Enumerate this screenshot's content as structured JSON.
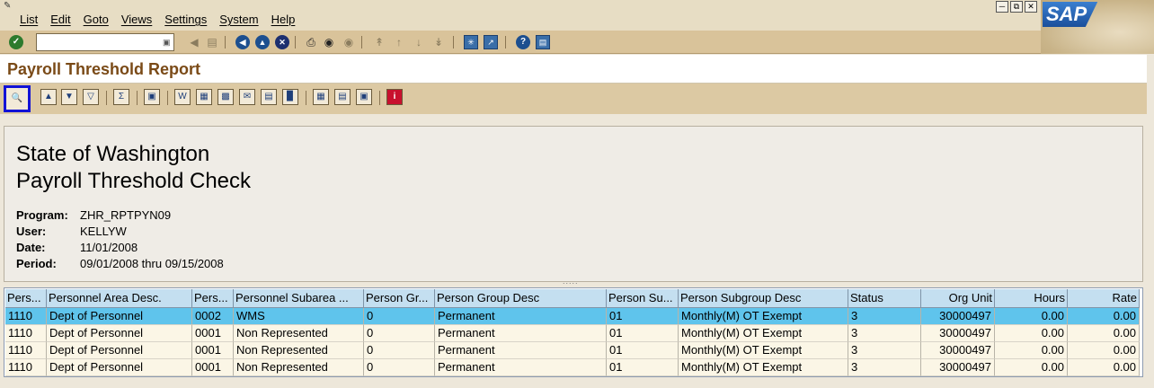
{
  "menu": {
    "items": [
      "List",
      "Edit",
      "Goto",
      "Views",
      "Settings",
      "System",
      "Help"
    ]
  },
  "logo": "SAP",
  "command_field": {
    "value": ""
  },
  "title": "Payroll Threshold Report",
  "report": {
    "title_line1": "State of Washington",
    "title_line2": "Payroll Threshold Check",
    "meta": [
      {
        "label": "Program:",
        "value": "ZHR_RPTPYN09"
      },
      {
        "label": "User:",
        "value": "KELLYW"
      },
      {
        "label": "Date:",
        "value": "11/01/2008"
      },
      {
        "label": "Period:",
        "value": "09/01/2008 thru 09/15/2008"
      }
    ]
  },
  "splitter": ".....",
  "table": {
    "columns": [
      "Pers...",
      "Personnel Area Desc.",
      "Pers...",
      "Personnel Subarea ...",
      "Person Gr...",
      "Person Group Desc",
      "Person Su...",
      "Person Subgroup Desc",
      "Status",
      "Org Unit",
      "Hours",
      "Rate"
    ],
    "rows": [
      [
        "1110",
        "Dept of Personnel",
        "0002",
        "WMS",
        "0",
        "Permanent",
        "01",
        "Monthly(M) OT Exempt",
        "3",
        "30000497",
        "0.00",
        "0.00"
      ],
      [
        "1110",
        "Dept of Personnel",
        "0001",
        "Non Represented",
        "0",
        "Permanent",
        "01",
        "Monthly(M) OT Exempt",
        "3",
        "30000497",
        "0.00",
        "0.00"
      ],
      [
        "1110",
        "Dept of Personnel",
        "0001",
        "Non Represented",
        "0",
        "Permanent",
        "01",
        "Monthly(M) OT Exempt",
        "3",
        "30000497",
        "0.00",
        "0.00"
      ],
      [
        "1110",
        "Dept of Personnel",
        "0001",
        "Non Represented",
        "0",
        "Permanent",
        "01",
        "Monthly(M) OT Exempt",
        "3",
        "30000497",
        "0.00",
        "0.00"
      ]
    ],
    "selected_row": 0
  },
  "colors": {
    "title": "#7a4a17",
    "selected_row": "#5fc4ec",
    "header_bg": "#c4dff0",
    "toolbar_bg": "#d9c39a"
  }
}
